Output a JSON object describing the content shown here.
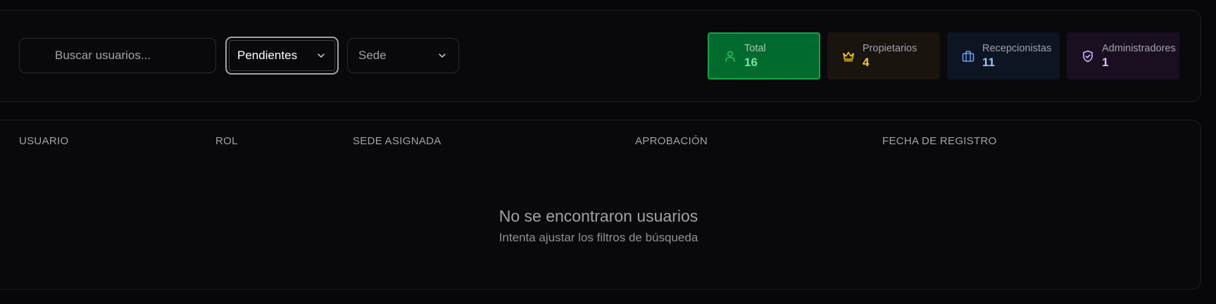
{
  "filters": {
    "search": {
      "placeholder": "Buscar usuarios...",
      "value": ""
    },
    "status_select": {
      "value": "Pendientes"
    },
    "branch_select": {
      "value": "Sede"
    }
  },
  "stats": [
    {
      "label": "Total",
      "value": "16",
      "icon": "user-icon",
      "accent": "#16a34a"
    },
    {
      "label": "Propietarios",
      "value": "4",
      "icon": "crown-icon",
      "accent": "#facc15"
    },
    {
      "label": "Recepcionistas",
      "value": "11",
      "icon": "briefcase-icon",
      "accent": "#60a5fa"
    },
    {
      "label": "Administradores",
      "value": "1",
      "icon": "shield-icon",
      "accent": "#d8b4fe"
    }
  ],
  "table": {
    "columns": [
      "USUARIO",
      "ROL",
      "SEDE ASIGNADA",
      "APROBACIÓN",
      "FECHA DE REGISTRO"
    ],
    "rows": [],
    "empty": {
      "title": "No se encontraron usuarios",
      "subtitle": "Intenta ajustar los filtros de búsqueda"
    }
  }
}
